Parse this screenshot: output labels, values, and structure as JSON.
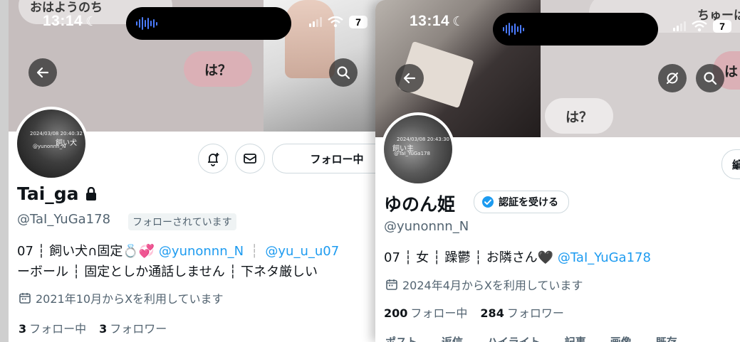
{
  "left": {
    "status": {
      "time": "13:14",
      "battery": "7"
    },
    "banner": {
      "bubble_top": "おはようのち",
      "bubble_pink": "は？"
    },
    "avatar_text": {
      "stamp": "2024/03/08 20:40:32",
      "label": "飼い犬",
      "handle": "@yunonnn_N"
    },
    "profile": {
      "name": "Tai_ga",
      "handle": "@TaI_YuGa178",
      "follows_you": "フォローされています",
      "follow_button": "フォロー中",
      "bio_line1_text": "07 ┆ 飼い犬∩固定💍💞",
      "bio_link1": "@yunonnn_N",
      "bio_sep": "┆",
      "bio_link2": "@yu_u_u07",
      "bio_line2": "ーボール ┆ 固定としか通話しません ┆ 下ネタ厳しい",
      "joined": "2021年10月からXを利用しています",
      "following_count": "3",
      "following_label": "フォロー中",
      "followers_count": "3",
      "followers_label": "フォロワー"
    }
  },
  "right": {
    "status": {
      "time": "13:14",
      "battery": "7"
    },
    "banner": {
      "bubble_top": "ちゅーは",
      "bubble_grey": "は？",
      "bubble_right": "は"
    },
    "avatar_text": {
      "stamp": "2024/03/08 20:43:30",
      "label": "飼い主",
      "handle": "@TaI_YuGa178"
    },
    "profile": {
      "name": "ゆのん姫",
      "verify_button": "認証を受ける",
      "handle": "@yunonnn_N",
      "bio_text": "07 ┆ 女 ┆ 躁鬱 ┆ お隣さん🖤",
      "bio_link": "@TaI_YuGa178",
      "joined": "2024年4月からXを利用しています",
      "following_count": "200",
      "following_label": "フォロー中",
      "followers_count": "284",
      "followers_label": "フォロワー",
      "edit_button_peek": "編"
    },
    "tabs_peek": [
      "ポスト",
      "返信",
      "ハイライト",
      "記事",
      "画像",
      "既存"
    ]
  },
  "colors": {
    "accent": "#1d9bf0",
    "text": "#0f1419",
    "muted": "#536471",
    "border": "#cfd9de"
  },
  "icons": [
    "back-arrow-icon",
    "search-icon",
    "moon-icon",
    "wifi-icon",
    "signal-icon",
    "lock-icon",
    "notification-add-icon",
    "mail-icon",
    "calendar-icon",
    "verified-badge-icon",
    "rotate-off-icon"
  ]
}
